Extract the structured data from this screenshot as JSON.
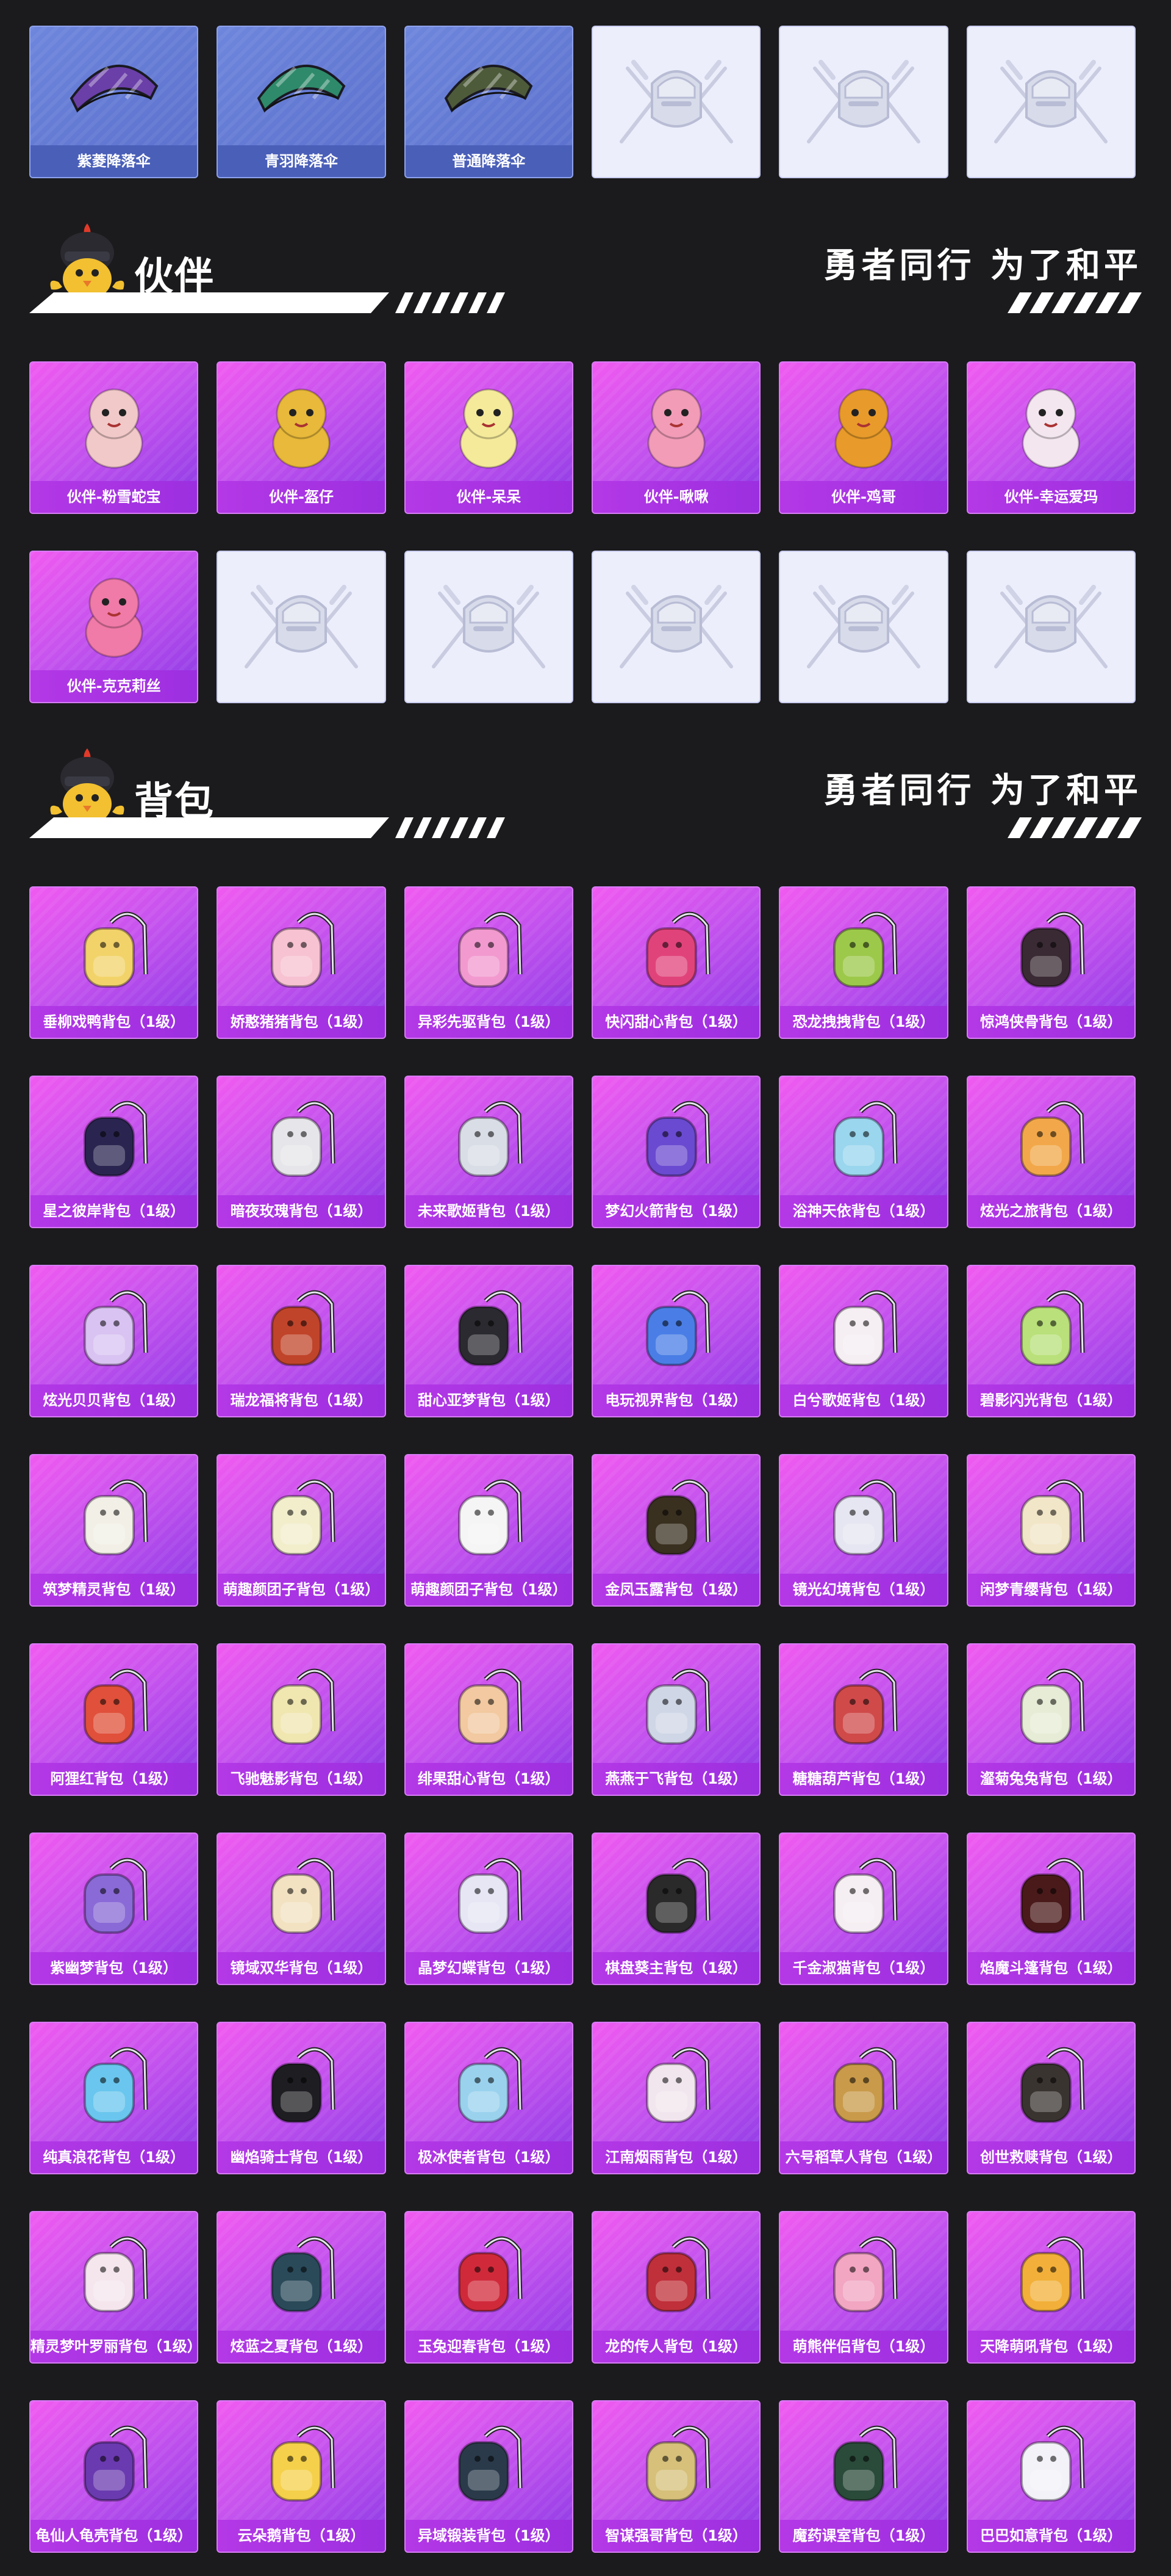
{
  "parachutes": [
    {
      "label": "紫菱降落伞",
      "icon": "parachute-icon",
      "color": "#6a3fa8"
    },
    {
      "label": "青羽降落伞",
      "icon": "parachute-icon",
      "color": "#2e8a6a"
    },
    {
      "label": "普通降落伞",
      "icon": "parachute-icon",
      "color": "#4e5b3a"
    },
    {
      "label": "",
      "icon": "locked-emblem-icon"
    },
    {
      "label": "",
      "icon": "locked-emblem-icon"
    },
    {
      "label": "",
      "icon": "locked-emblem-icon"
    }
  ],
  "companion_section": {
    "title": "伙伴",
    "slogan": "勇者同行 为了和平"
  },
  "companions": [
    {
      "label": "伙伴-粉雪蛇宝",
      "color": "#f2c9c9"
    },
    {
      "label": "伙伴-盔仔",
      "color": "#e8b93a"
    },
    {
      "label": "伙伴-呆呆",
      "color": "#f5ea9a"
    },
    {
      "label": "伙伴-啾啾",
      "color": "#f29cb8"
    },
    {
      "label": "伙伴-鸡哥",
      "color": "#e89b2a"
    },
    {
      "label": "伙伴-幸运爱玛",
      "color": "#f4e6ef"
    },
    {
      "label": "伙伴-克克莉丝",
      "color": "#f07aa8"
    },
    {
      "label": "",
      "icon": "locked-emblem-icon"
    },
    {
      "label": "",
      "icon": "locked-emblem-icon"
    },
    {
      "label": "",
      "icon": "locked-emblem-icon"
    },
    {
      "label": "",
      "icon": "locked-emblem-icon"
    },
    {
      "label": "",
      "icon": "locked-emblem-icon"
    }
  ],
  "backpack_section": {
    "title": "背包",
    "slogan": "勇者同行 为了和平"
  },
  "backpacks": [
    {
      "label": "垂柳戏鸭背包（1级）",
      "color": "#f2d36a"
    },
    {
      "label": "娇憨猪猪背包（1级）",
      "color": "#f7c2d2"
    },
    {
      "label": "异彩先驱背包（1级）",
      "color": "#f29ad0"
    },
    {
      "label": "快闪甜心背包（1级）",
      "color": "#e0437a"
    },
    {
      "label": "恐龙拽拽背包（1级）",
      "color": "#9cc94a"
    },
    {
      "label": "惊鸿侠骨背包（1级）",
      "color": "#3a2a33"
    },
    {
      "label": "星之彼岸背包（1级）",
      "color": "#2a2550"
    },
    {
      "label": "暗夜玫瑰背包（1级）",
      "color": "#e6e6ea"
    },
    {
      "label": "未来歌姬背包（1级）",
      "color": "#d9dde6"
    },
    {
      "label": "梦幻火箭背包（1级）",
      "color": "#6a4ad0"
    },
    {
      "label": "浴神天依背包（1级）",
      "color": "#9ad6ee"
    },
    {
      "label": "炫光之旅背包（1级）",
      "color": "#f2a84a"
    },
    {
      "label": "炫光贝贝背包（1级）",
      "color": "#d9c3f2"
    },
    {
      "label": "瑞龙福将背包（1级）",
      "color": "#c0442a"
    },
    {
      "label": "甜心亚梦背包（1级）",
      "color": "#2a2a30"
    },
    {
      "label": "电玩视界背包（1级）",
      "color": "#4a7ee6"
    },
    {
      "label": "白兮歌姬背包（1级）",
      "color": "#f5eef2"
    },
    {
      "label": "碧影闪光背包（1级）",
      "color": "#b9e07a"
    },
    {
      "label": "筑梦精灵背包（1级）",
      "color": "#f2f0e6"
    },
    {
      "label": "萌趣颜团子背包（1级）",
      "color": "#f2eecc"
    },
    {
      "label": "萌趣颜团子背包（1级）",
      "color": "#f5f5f5"
    },
    {
      "label": "金凤玉露背包（1级）",
      "color": "#3a3020"
    },
    {
      "label": "镜光幻境背包（1级）",
      "color": "#e6e6f2"
    },
    {
      "label": "闲梦青缨背包（1级）",
      "color": "#f2e6c8"
    },
    {
      "label": "阿狸红背包（1级）",
      "color": "#e0503a"
    },
    {
      "label": "飞驰魅影背包（1级）",
      "color": "#f0e6b0"
    },
    {
      "label": "绯果甜心背包（1级）",
      "color": "#f2c9a0"
    },
    {
      "label": "燕燕于飞背包（1级）",
      "color": "#cfd6e6"
    },
    {
      "label": "糖糖葫芦背包（1级）",
      "color": "#d04a4a"
    },
    {
      "label": "瀣菊兔兔背包（1级）",
      "color": "#e6ecd6"
    },
    {
      "label": "紫幽梦背包（1级）",
      "color": "#8a6ad6"
    },
    {
      "label": "镜域双华背包（1级）",
      "color": "#f2e2c2"
    },
    {
      "label": "晶梦幻蝶背包（1级）",
      "color": "#e6e6f5"
    },
    {
      "label": "棋盘葵主背包（1级）",
      "color": "#2a2a2a"
    },
    {
      "label": "千金淑猫背包（1级）",
      "color": "#f5eef2"
    },
    {
      "label": "焰魔斗篷背包（1级）",
      "color": "#4a1a1a"
    },
    {
      "label": "纯真浪花背包（1级）",
      "color": "#6ac6ee"
    },
    {
      "label": "幽焰骑士背包（1级）",
      "color": "#1e1e22"
    },
    {
      "label": "极冰使者背包（1级）",
      "color": "#9ad2ee"
    },
    {
      "label": "江南烟雨背包（1级）",
      "color": "#f2e6ee"
    },
    {
      "label": "六号稻草人背包（1级）",
      "color": "#c89a4a"
    },
    {
      "label": "创世救赎背包（1级）",
      "color": "#3a3430"
    },
    {
      "label": "精灵梦叶罗丽背包（1级）",
      "color": "#f5e6ee"
    },
    {
      "label": "炫蓝之夏背包（1级）",
      "color": "#2a4a5a"
    },
    {
      "label": "玉兔迎春背包（1级）",
      "color": "#d02a3a"
    },
    {
      "label": "龙的传人背包（1级）",
      "color": "#c0303a"
    },
    {
      "label": "萌熊伴侣背包（1级）",
      "color": "#f2a6c2"
    },
    {
      "label": "天降萌吼背包（1级）",
      "color": "#f2b03a"
    },
    {
      "label": "龟仙人龟壳背包（1级）",
      "color": "#6a3ab0"
    },
    {
      "label": "云朵鹅背包（1级）",
      "color": "#f5d04a"
    },
    {
      "label": "异域锻装背包（1级）",
      "color": "#2a3a4a"
    },
    {
      "label": "智谋强哥背包（1级）",
      "color": "#d6c07a"
    },
    {
      "label": "魔药课室背包（1级）",
      "color": "#2a4a3a"
    },
    {
      "label": "巴巴如意背包（1级）",
      "color": "#f2f2f8"
    }
  ],
  "icons": {
    "companion_mascot": "helmet-chick-mascot-icon",
    "locked": "locked-emblem-icon",
    "parachute": "parachute-icon",
    "backpack": "backpack-icon",
    "companion": "companion-figure-icon"
  }
}
